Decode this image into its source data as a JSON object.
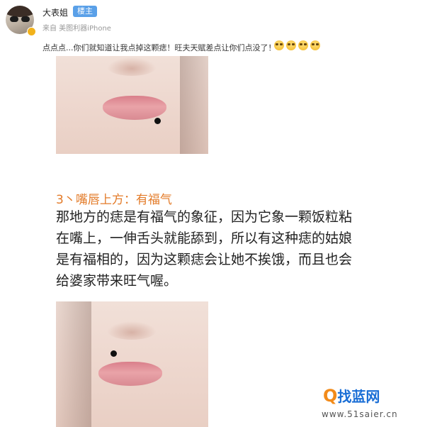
{
  "post": {
    "username": "大表姐",
    "badge": "楼主",
    "source": "来自 美图利器iPhone",
    "comment": "点点点...你们就知道让我点掉这颗痣！旺夫天赋差点让你们点没了！",
    "emojis": [
      "shy-face-emoji",
      "shy-face-emoji",
      "shy-face-emoji",
      "shy-face-emoji"
    ]
  },
  "article": {
    "section_title": "3丶嘴唇上方：有福气",
    "body_lines": [
      "那地方的痣是有福气的象征，因为它象一颗饭粒粘",
      "在嘴上，一伸舌头就能舔到，所以有这种痣的姑娘",
      "是有福相的，因为这颗痣会让她不挨饿，而且也会",
      "给婆家带来旺气喔。"
    ]
  },
  "watermark": {
    "logo": "找蓝网",
    "url": "www.51saier.cn"
  },
  "colors": {
    "accent": "#e37b29",
    "badge": "#5aa0e8",
    "watermark": "#1b6fd6"
  }
}
